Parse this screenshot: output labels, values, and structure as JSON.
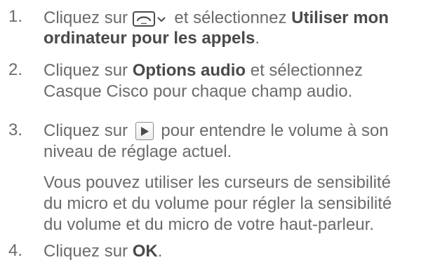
{
  "steps": [
    {
      "number": "1.",
      "line1_before": "Cliquez sur ",
      "line1_after": " et sélectionnez ",
      "line1_bold": "Utiliser mon",
      "line2_bold": "ordinateur pour les appels",
      "line2_after": ".",
      "icons": [
        "call-device-icon",
        "chevron-down-icon"
      ]
    },
    {
      "number": "2.",
      "line1_before": "Cliquez sur ",
      "line1_bold": "Options audio",
      "line1_after": " et sélectionnez",
      "line2": "Casque Cisco pour chaque champ audio."
    },
    {
      "number": "3.",
      "line1_before": "Cliquez sur ",
      "line1_after": " pour entendre le volume à son",
      "line2": "niveau de réglage actuel.",
      "icons": [
        "play-icon"
      ]
    },
    {
      "note_lines": [
        "Vous pouvez utiliser les curseurs de sensibilité",
        "du micro et du volume pour régler la sensibilité",
        "du volume et du micro de votre haut-parleur."
      ]
    },
    {
      "number": "4.",
      "line1_before": "Cliquez sur ",
      "line1_bold": "OK",
      "line1_after": "."
    }
  ],
  "colors": {
    "text": "#6b6b6b",
    "bold": "#4a4a4a"
  }
}
